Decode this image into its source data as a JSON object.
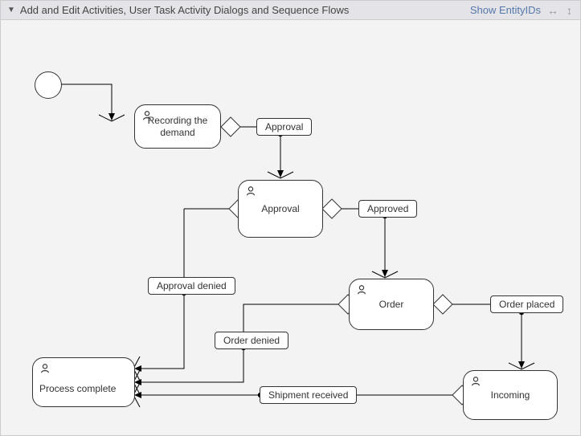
{
  "header": {
    "title": "Add and Edit Activities, User Task Activity Dialogs and Sequence Flows",
    "show_entity_ids": "Show EntityIDs"
  },
  "nodes": {
    "recording": "Recording the demand",
    "approval_task": "Approval",
    "order_task": "Order",
    "incoming_task": "Incoming",
    "process_complete": "Process complete"
  },
  "edges": {
    "approval": "Approval",
    "approved": "Approved",
    "approval_denied": "Approval denied",
    "order_placed": "Order placed",
    "order_denied": "Order denied",
    "shipment_received": "Shipment received"
  }
}
